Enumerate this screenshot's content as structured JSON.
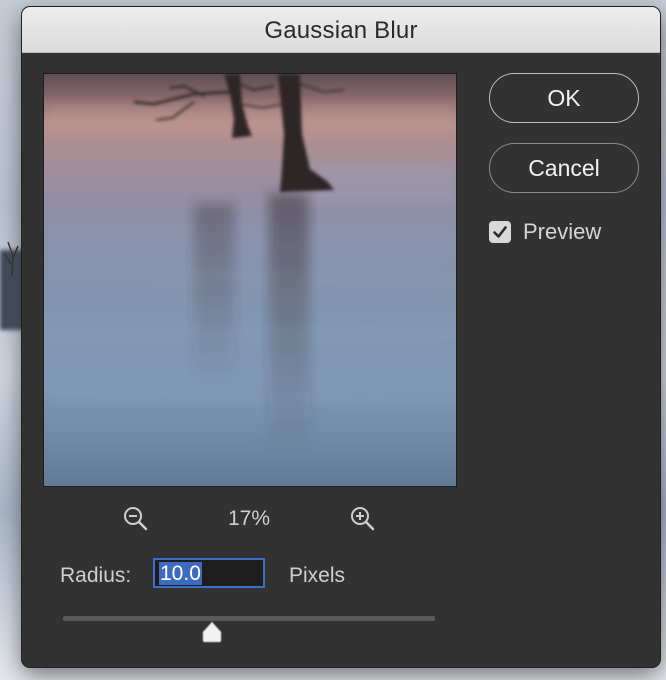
{
  "dialog": {
    "title": "Gaussian Blur"
  },
  "buttons": {
    "ok_label": "OK",
    "cancel_label": "Cancel"
  },
  "preview_toggle": {
    "label": "Preview",
    "checked": true
  },
  "zoom": {
    "level": "17%",
    "zoom_out_icon": "zoom-out-icon",
    "zoom_in_icon": "zoom-in-icon"
  },
  "radius": {
    "label": "Radius:",
    "value": "10.0",
    "unit_label": "Pixels",
    "slider_fraction": 0.4
  },
  "colors": {
    "dialog_bg": "#323232",
    "text": "#cfcfcf",
    "selection": "#3d6bc2",
    "focus_border": "#3b70c6"
  }
}
